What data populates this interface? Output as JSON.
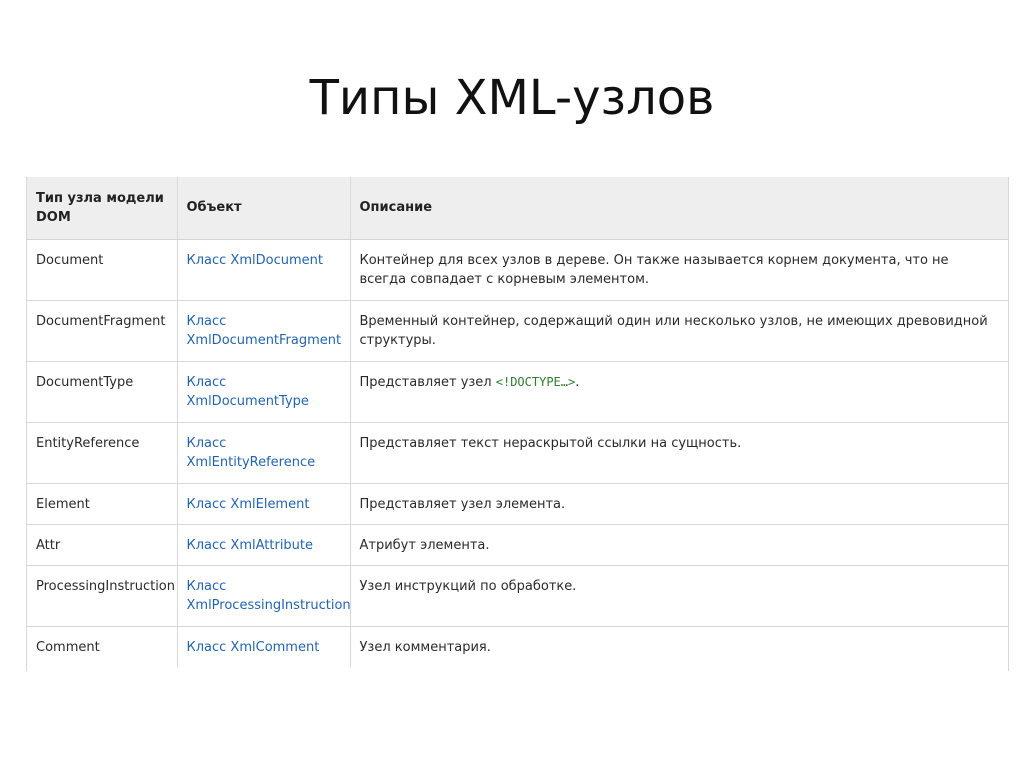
{
  "slide": {
    "title": "Типы XML-узлов"
  },
  "table": {
    "headers": {
      "type": "Тип узла модели DOM",
      "object": "Объект",
      "description": "Описание"
    },
    "rows": [
      {
        "type": "Document",
        "object": "Класс XmlDocument",
        "description": "Контейнер для всех узлов в дереве. Он также называется корнем документа, что не всегда совпадает с корневым элементом."
      },
      {
        "type": "DocumentFragment",
        "object": "Класс XmlDocumentFragment",
        "description": "Временный контейнер, содержащий один или несколько узлов, не имеющих древовидной структуры."
      },
      {
        "type": "DocumentType",
        "object": "Класс XmlDocumentType",
        "description_prefix": "Представляет узел ",
        "description_code": "<!DOCTYPE…>",
        "description_suffix": "."
      },
      {
        "type": "EntityReference",
        "object": "Класс XmlEntityReference",
        "description": "Представляет текст нераскрытой ссылки на сущность."
      },
      {
        "type": "Element",
        "object": "Класс XmlElement",
        "description": "Представляет узел элемента."
      },
      {
        "type": "Attr",
        "object": "Класс XmlAttribute",
        "description": "Атрибут элемента."
      },
      {
        "type": "ProcessingInstruction",
        "object": "Класс XmlProcessingInstruction",
        "description": "Узел инструкций по обработке."
      },
      {
        "type": "Comment",
        "object": "Класс XmlComment",
        "description": "Узел комментария."
      }
    ]
  },
  "colors": {
    "link": "#2364b0",
    "code": "#2d7d2d",
    "header_bg": "#eeeeee",
    "border": "#d8d8d8"
  }
}
